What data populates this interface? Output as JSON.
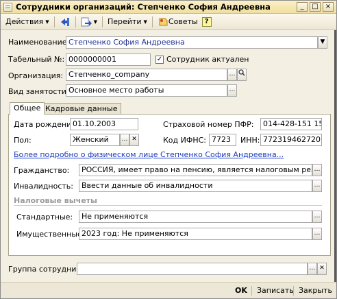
{
  "window": {
    "title": "Сотрудники организаций: Степченко София Андреевна",
    "controls": [
      "_",
      "□",
      "×"
    ]
  },
  "toolbar": {
    "actions_label": "Действия",
    "goto_label": "Перейти",
    "tips_label": "Советы",
    "help_label": "?"
  },
  "form": {
    "name_label": "Наименование:",
    "name_value": "Степченко София Андреевна",
    "tabnum_label": "Табельный №:",
    "tabnum_value": "0000000001",
    "active_label": "Сотрудник актуален",
    "active_checked": "✓",
    "org_label": "Организация:",
    "org_value": "Степченко_company",
    "employment_label": "Вид занятости:",
    "employment_value": "Основное место работы"
  },
  "tabs": [
    "Общее",
    "Кадровые данные"
  ],
  "general": {
    "birth_label": "Дата рождения:",
    "birth_value": "01.10.2003",
    "snils_label": "Страховой номер ПФР:",
    "snils_value": "014-428-151 15",
    "gender_label": "Пол:",
    "gender_value": "Женский",
    "ifns_label": "Код ИФНС:",
    "ifns_value": "7723",
    "inn_label": "ИНН:",
    "inn_value": "772319462720",
    "details_link": "Более подробно о физическом лице Степченко София Андреевна...",
    "citizenship_label": "Гражданство:",
    "citizenship_value": "РОССИЯ, имеет право на пенсию, является налоговым резидент",
    "disability_label": "Инвалидность:",
    "disability_value": "Ввести данные об инвалидности",
    "tax_group_title": "Налоговые вычеты",
    "standard_label": "Стандартные:",
    "standard_value": "Не применяются",
    "property_label": "Имущественные:",
    "property_value": "2023 год: Не применяются"
  },
  "footer": {
    "group_label": "Группа сотрудника:",
    "group_value": "",
    "ok_label": "OK",
    "save_label": "Записать",
    "close_label": "Закрыть"
  }
}
